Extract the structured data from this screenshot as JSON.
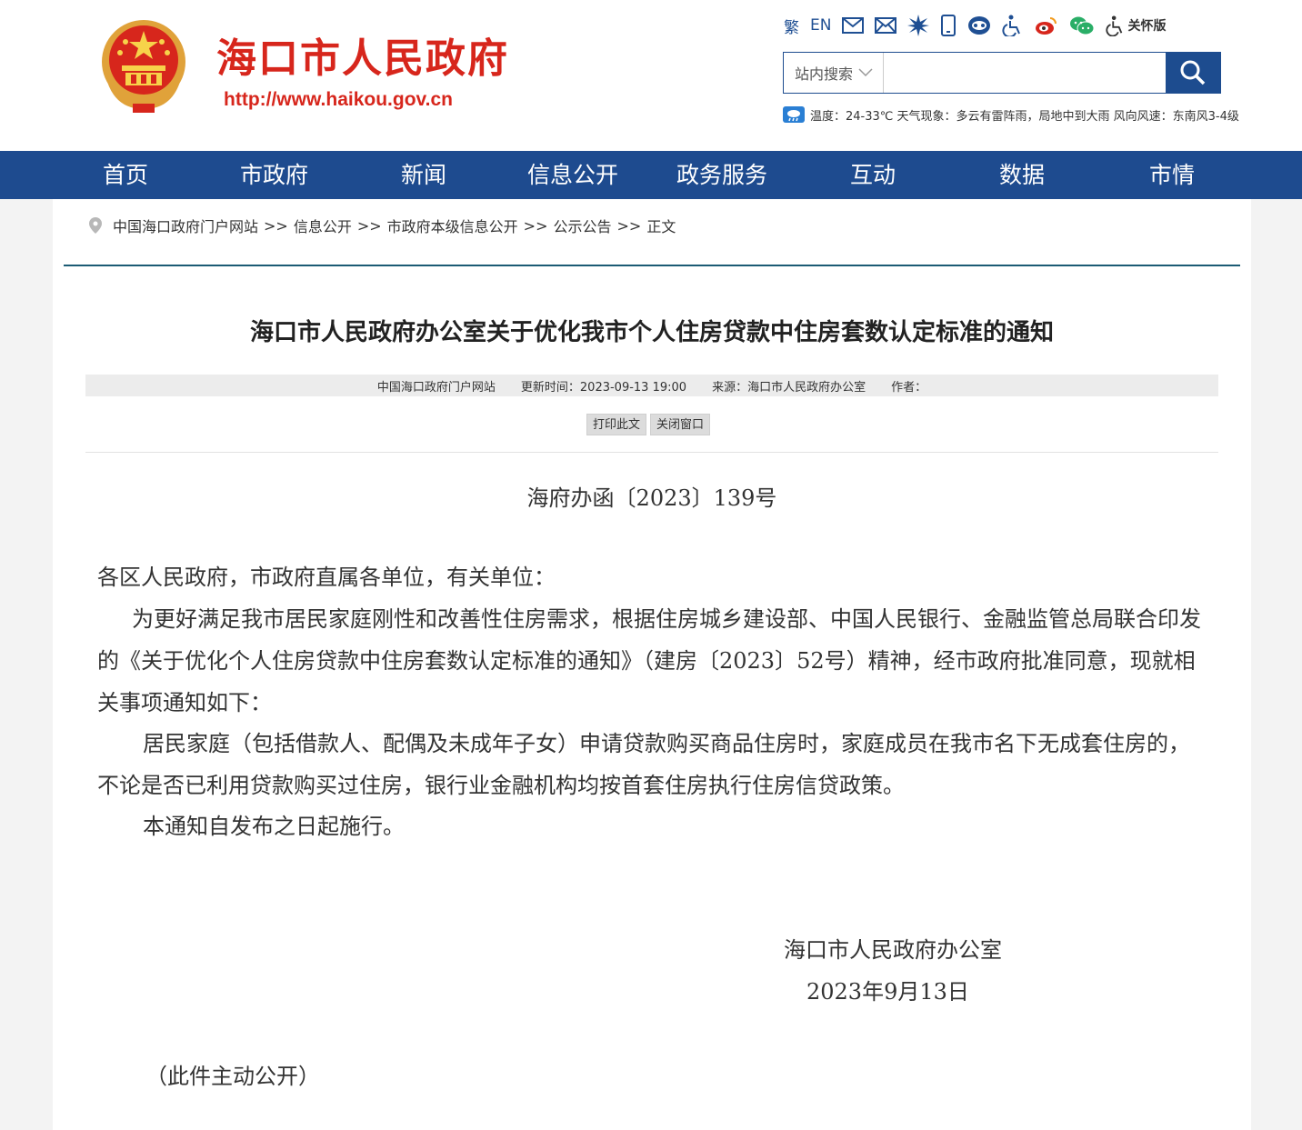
{
  "site": {
    "title": "海口市人民政府",
    "url": "http://www.haikou.gov.cn"
  },
  "toolbar": {
    "traditional": "繁",
    "english": "EN",
    "care_label": "关怀版",
    "icons": [
      "mail-icon",
      "envelope-icon",
      "star-sun-icon",
      "mobile-icon",
      "robot-icon",
      "accessibility-icon",
      "weibo-icon",
      "wechat-icon",
      "care-mode-icon"
    ]
  },
  "search": {
    "scope": "站内搜索",
    "placeholder": ""
  },
  "weather": {
    "text": "温度：24-33℃ 天气现象：多云有雷阵雨，局地中到大雨 风向风速：东南风3-4级"
  },
  "nav": {
    "items": [
      "首页",
      "市政府",
      "新闻",
      "信息公开",
      "政务服务",
      "互动",
      "数据",
      "市情"
    ]
  },
  "breadcrumb": {
    "items": [
      "中国海口政府门户网站",
      "信息公开",
      "市政府本级信息公开",
      "公示公告",
      "正文"
    ],
    "separator": ">>"
  },
  "article": {
    "title": "海口市人民政府办公室关于优化我市个人住房贷款中住房套数认定标准的通知",
    "meta": {
      "site": "中国海口政府门户网站",
      "updated": "更新时间：2023-09-13 19:00",
      "source": "来源：海口市人民政府办公室",
      "author": "作者："
    },
    "print_label": "打印此文",
    "close_label": "关闭窗口",
    "doc_no": "海府办函〔2023〕139号",
    "salutation": "各区人民政府，市政府直属各单位，有关单位：",
    "para1": "为更好满足我市居民家庭刚性和改善性住房需求，根据住房城乡建设部、中国人民银行、金融监管总局联合印发的《关于优化个人住房贷款中住房套数认定标准的通知》（建房〔2023〕52号）精神，经市政府批准同意，现就相关事项通知如下：",
    "para2": "居民家庭（包括借款人、配偶及未成年子女）申请贷款购买商品住房时，家庭成员在我市名下无成套住房的，不论是否已利用贷款购买过住房，银行业金融机构均按首套住房执行住房信贷政策。",
    "para3": "本通知自发布之日起施行。",
    "signer": "海口市人民政府办公室",
    "date": "2023年9月13日",
    "public_note": "（此件主动公开）"
  },
  "colors": {
    "brand_red": "#d7261c",
    "nav_blue": "#1e4b8f",
    "rule_teal": "#1b5b74"
  }
}
